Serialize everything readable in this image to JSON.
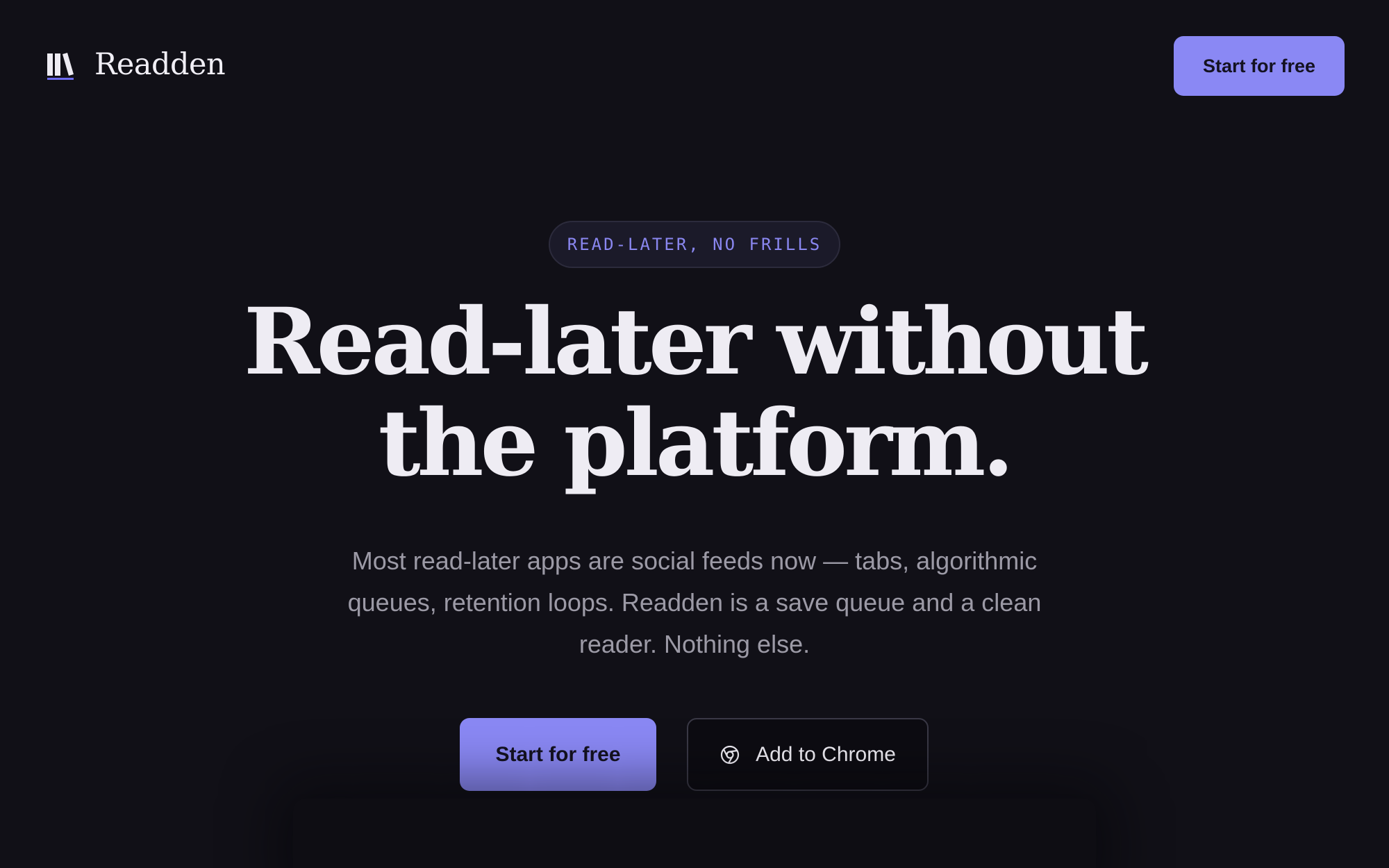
{
  "header": {
    "brand_name": "Readden",
    "brand_icon": "books-icon",
    "cta_label": "Start for free"
  },
  "hero": {
    "eyebrow": "READ-LATER, NO FRILLS",
    "headline_line1": "Read-later without",
    "headline_line2": "the platform.",
    "subtitle": "Most read-later apps are social feeds now — tabs, algorithmic queues, retention loops. Readden is a save queue and a clean reader. Nothing else.",
    "primary_cta": "Start for free",
    "secondary_cta": "Add to Chrome",
    "secondary_icon": "chrome-icon"
  },
  "colors": {
    "background": "#111017",
    "accent": "#8a88f4",
    "eyebrow_text": "#8a87f0",
    "headline_text": "#eeecf3",
    "subtitle_text": "#9c9aa6"
  }
}
